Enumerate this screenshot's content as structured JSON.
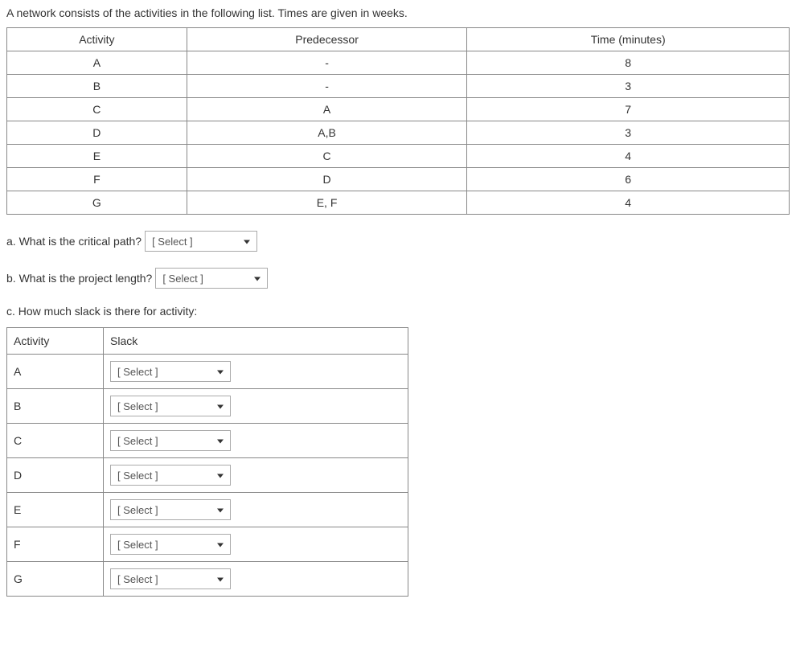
{
  "intro": "A network consists of the activities in the following list. Times are given in weeks.",
  "table": {
    "headers": {
      "activity": "Activity",
      "predecessor": "Predecessor",
      "time": "Time (minutes)"
    },
    "rows": [
      {
        "activity": "A",
        "predecessor": "-",
        "time": "8"
      },
      {
        "activity": "B",
        "predecessor": "-",
        "time": "3"
      },
      {
        "activity": "C",
        "predecessor": "A",
        "time": "7"
      },
      {
        "activity": "D",
        "predecessor": "A,B",
        "time": "3"
      },
      {
        "activity": "E",
        "predecessor": "C",
        "time": "4"
      },
      {
        "activity": "F",
        "predecessor": "D",
        "time": "6"
      },
      {
        "activity": "G",
        "predecessor": "E, F",
        "time": "4"
      }
    ]
  },
  "questions": {
    "a": {
      "label": "a. What is the critical path?",
      "select": "[ Select ]"
    },
    "b": {
      "label": "b. What is the project length?",
      "select": "[ Select ]"
    },
    "c": {
      "label": "c. How much slack is there for activity:"
    }
  },
  "slack_table": {
    "headers": {
      "activity": "Activity",
      "slack": "Slack"
    },
    "rows": [
      {
        "activity": "A",
        "select": "[ Select ]"
      },
      {
        "activity": "B",
        "select": "[ Select ]"
      },
      {
        "activity": "C",
        "select": "[ Select ]"
      },
      {
        "activity": "D",
        "select": "[ Select ]"
      },
      {
        "activity": "E",
        "select": "[ Select ]"
      },
      {
        "activity": "F",
        "select": "[ Select ]"
      },
      {
        "activity": "G",
        "select": "[ Select ]"
      }
    ]
  }
}
